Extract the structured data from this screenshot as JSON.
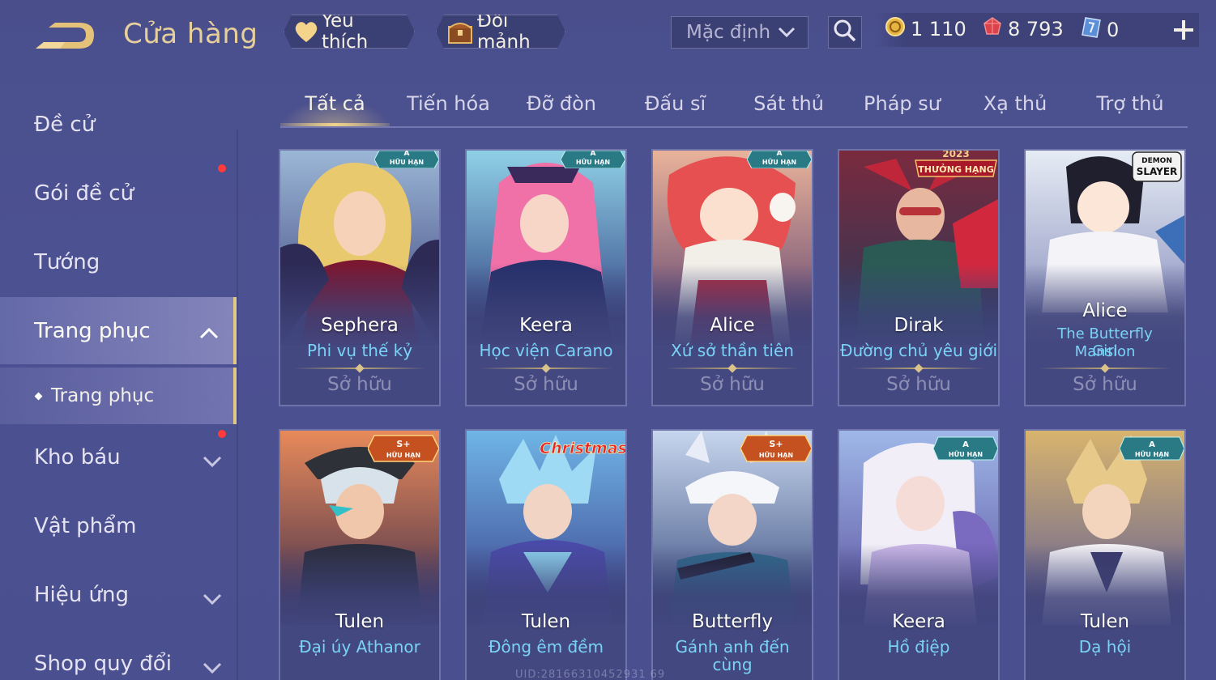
{
  "header": {
    "title": "Cửa hàng",
    "favorites_label": "Yêu thích",
    "exchange_label": "Đổi mảnh",
    "sort_value": "Mặc định",
    "currencies": {
      "gold": "1 110",
      "gems": "8 793",
      "tickets": "0"
    }
  },
  "sidebar": {
    "items": [
      {
        "label": "Đề cử"
      },
      {
        "label": "Gói đề cử"
      },
      {
        "label": "Tướng"
      },
      {
        "label": "Trang phục"
      },
      {
        "label": "Kho báu"
      },
      {
        "label": "Vật phẩm"
      },
      {
        "label": "Hiệu ứng"
      },
      {
        "label": "Shop quy đổi"
      }
    ],
    "sub_item": "Trang phục"
  },
  "tabs": [
    "Tất cả",
    "Tiến hóa",
    "Đỡ đòn",
    "Đấu sĩ",
    "Sát thủ",
    "Pháp sư",
    "Xạ thủ",
    "Trợ thủ"
  ],
  "cards": [
    {
      "hero": "Sephera",
      "skin": "Phi vụ thế kỷ",
      "status": "Sở hữu",
      "badge_tier": "A",
      "badge_text": "HỮU HẠN"
    },
    {
      "hero": "Keera",
      "skin": "Học viện Carano",
      "status": "Sở hữu",
      "badge_tier": "A",
      "badge_text": "HỮU HẠN"
    },
    {
      "hero": "Alice",
      "skin": "Xứ sở thần tiên",
      "status": "Sở hữu",
      "badge_tier": "A",
      "badge_text": "HỮU HẠN"
    },
    {
      "hero": "Dirak",
      "skin": "Đường chủ yêu giới",
      "status": "Sở hữu",
      "badge_top": "2023",
      "badge_text": "THƯỞNG HẠNG"
    },
    {
      "hero": "Alice",
      "skin_line1": "The Butterfly Mansion",
      "skin_line2": "Girl",
      "status": "Sở hữu",
      "badge_top": "DEMON",
      "badge_text": "SLAYER"
    },
    {
      "hero": "Tulen",
      "skin": "Đại úy Athanor",
      "status": "Sở hữu",
      "badge_tier": "S+",
      "badge_text": "HỮU HẠN"
    },
    {
      "hero": "Tulen",
      "skin": "Đông êm đềm",
      "status": "Sở hữu",
      "badge_text": "Christmas"
    },
    {
      "hero": "Butterfly",
      "skin": "Gánh anh đến cùng",
      "status": "Sở hữu",
      "badge_tier": "S+",
      "badge_text": "HỮU HẠN"
    },
    {
      "hero": "Keera",
      "skin": "Hồ điệp",
      "status": "Sở hữu",
      "badge_tier": "A",
      "badge_text": "HỮU HẠN"
    },
    {
      "hero": "Tulen",
      "skin": "Dạ hội",
      "status": "Sở hữu",
      "badge_tier": "A",
      "badge_text": "HỮU HẠN"
    }
  ],
  "watermark": "UID:28166310452931 69",
  "colors": {
    "accent_gold": "#e2c983",
    "skin_name_blue": "#7ad3f5",
    "notification_red": "#ff3b3b"
  }
}
